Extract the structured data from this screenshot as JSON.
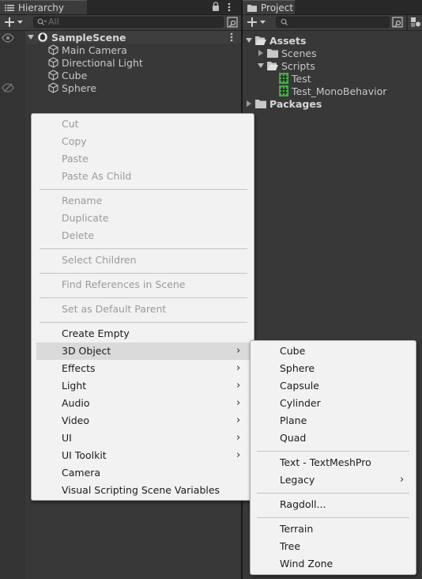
{
  "hierarchy": {
    "tab_label": "Hierarchy",
    "search_placeholder": "All",
    "scene": "SampleScene",
    "objects": [
      "Main Camera",
      "Directional Light",
      "Cube",
      "Sphere"
    ]
  },
  "project": {
    "tab_label": "Project",
    "tree": {
      "assets": "Assets",
      "scenes": "Scenes",
      "scripts": "Scripts",
      "test": "Test",
      "test_mono": "Test_MonoBehavior",
      "packages": "Packages"
    }
  },
  "context_menu": {
    "items": [
      "Cut",
      "Copy",
      "Paste",
      "Paste As Child",
      "Rename",
      "Duplicate",
      "Delete",
      "Select Children",
      "Find References in Scene",
      "Set as Default Parent",
      "Create Empty",
      "3D Object",
      "Effects",
      "Light",
      "Audio",
      "Video",
      "UI",
      "UI Toolkit",
      "Camera",
      "Visual Scripting Scene Variables"
    ],
    "highlighted": "3D Object"
  },
  "submenu_3d": {
    "items": [
      "Cube",
      "Sphere",
      "Capsule",
      "Cylinder",
      "Plane",
      "Quad",
      "Text - TextMeshPro",
      "Legacy",
      "Ragdoll...",
      "Terrain",
      "Tree",
      "Wind Zone"
    ]
  },
  "colors": {
    "panel_bg": "#383838",
    "menu_bg": "#f2f2f2",
    "menu_highlight": "#dadada",
    "disabled_text": "#9a9a9a",
    "script_icon_green": "#3fae42"
  }
}
